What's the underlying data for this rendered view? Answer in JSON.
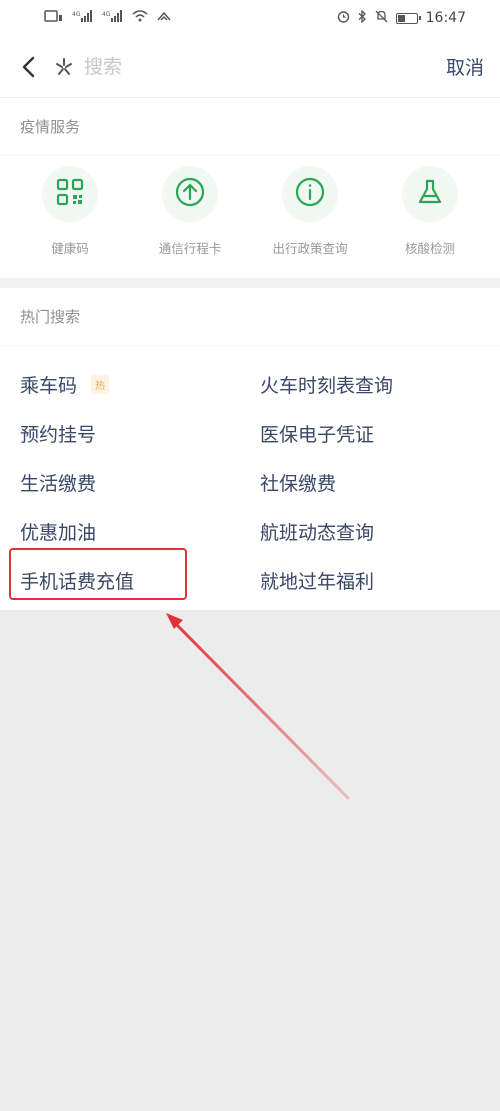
{
  "status_bar": {
    "left_icons": [
      "sim-icon",
      "signal-icon",
      "signal-icon",
      "wifi-icon",
      "data-speed-icon"
    ],
    "right_icons": [
      "alarm-icon",
      "bluetooth-icon",
      "mute-icon",
      "battery-icon"
    ],
    "battery_level": 0.45,
    "time": "16:47"
  },
  "header": {
    "search_placeholder": "搜索",
    "cancel_label": "取消"
  },
  "services": {
    "title": "疫情服务",
    "items": [
      {
        "label": "健康码",
        "icon": "qr-code-icon"
      },
      {
        "label": "通信行程卡",
        "icon": "upload-arrow-icon"
      },
      {
        "label": "出行政策查询",
        "icon": "info-icon"
      },
      {
        "label": "核酸检测",
        "icon": "flask-icon"
      }
    ],
    "icon_color": "#2aa654"
  },
  "hot_search": {
    "title": "热门搜索",
    "badge": "热",
    "items": [
      {
        "label": "乘车码"
      },
      {
        "label": "火车时刻表查询"
      },
      {
        "label": "预约挂号"
      },
      {
        "label": "医保电子凭证"
      },
      {
        "label": "生活缴费"
      },
      {
        "label": "社保缴费"
      },
      {
        "label": "优惠加油"
      },
      {
        "label": "航班动态查询"
      },
      {
        "label": "手机话费充值"
      },
      {
        "label": "就地过年福利"
      }
    ]
  },
  "annotation": {
    "highlighted_item": "手机话费充值",
    "color": "#e0323a"
  }
}
